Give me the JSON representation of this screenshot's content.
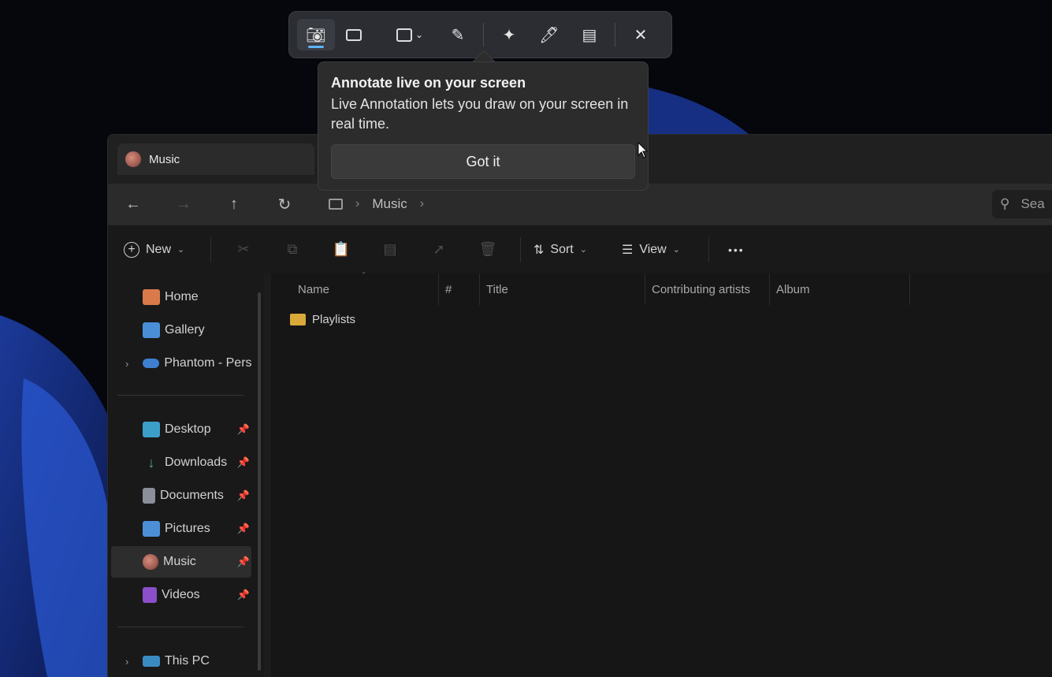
{
  "snipping_toolbar": {
    "screenshot_mode": "camera-icon",
    "video_mode": "video-icon",
    "snip_shape": "rectangle-icon",
    "edit": "edit-image-icon",
    "text_actions": "text-actions-icon",
    "live_annotation": "pen-icon",
    "ocr": "ocr-icon",
    "close": "close-icon",
    "accent": "#5db4ff"
  },
  "popup": {
    "title": "Annotate live on your screen",
    "body": "Live Annotation lets you draw on your screen in real time.",
    "button": "Got it"
  },
  "explorer": {
    "tab_title": "Music",
    "breadcrumb": [
      "Music"
    ],
    "search_placeholder": "Sea",
    "toolbar": {
      "new_label": "New",
      "sort_label": "Sort",
      "view_label": "View",
      "more_label": "•••"
    },
    "sidebar": {
      "items": [
        {
          "label": "Home"
        },
        {
          "label": "Gallery"
        },
        {
          "label": "Phantom - Persc"
        },
        {
          "label": "Desktop"
        },
        {
          "label": "Downloads"
        },
        {
          "label": "Documents"
        },
        {
          "label": "Pictures"
        },
        {
          "label": "Music"
        },
        {
          "label": "Videos"
        },
        {
          "label": "This PC"
        }
      ]
    },
    "columns": [
      "Name",
      "#",
      "Title",
      "Contributing artists",
      "Album"
    ],
    "rows": [
      {
        "name": "Playlists"
      }
    ]
  }
}
